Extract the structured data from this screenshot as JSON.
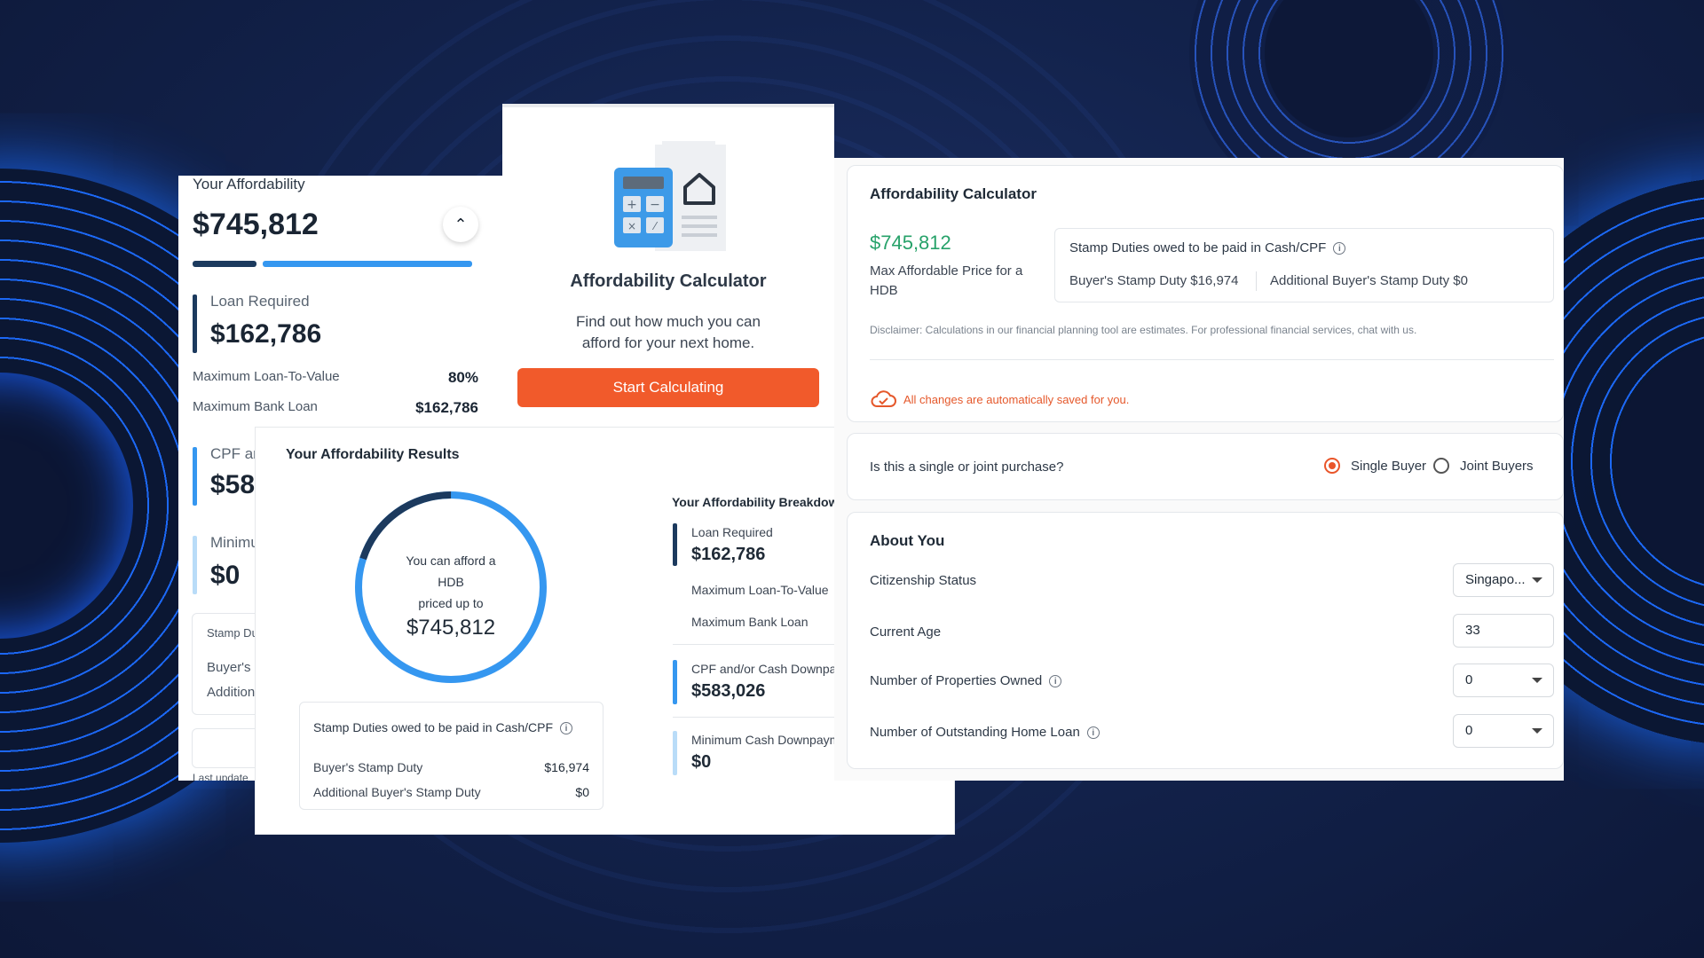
{
  "left_card": {
    "label": "Your Affordability",
    "amount": "$745,812",
    "loan_label": "Loan Required",
    "loan_value": "$162,786",
    "ltv_label": "Maximum Loan-To-Value",
    "ltv_value": "80%",
    "bank_loan_label": "Maximum Bank Loan",
    "bank_loan_value": "$162,786",
    "cpf_label_partial": "CPF ar",
    "cpf_value_partial": "$58",
    "min_label_partial": "Minimu",
    "min_value": "$0",
    "stamp_partial": "Stamp Du",
    "buyer_partial": "Buyer's",
    "additional_partial": "Addition",
    "last_update_partial": "Last update"
  },
  "intro_card": {
    "title": "Affordability Calculator",
    "description": "Find out how much you can afford for your next home.",
    "button": "Start Calculating"
  },
  "results_card": {
    "title": "Your Affordability Results",
    "donut_line1": "You can afford a",
    "donut_line2": "HDB",
    "donut_line3": "priced up to",
    "donut_value": "$745,812",
    "donut_fraction_dark": 0.2,
    "stamp_title": "Stamp Duties owed to be paid in Cash/CPF",
    "bsd_label": "Buyer's Stamp Duty",
    "bsd_value": "$16,974",
    "absd_label": "Additional Buyer's Stamp Duty",
    "absd_value": "$0",
    "breakdown_title": "Your Affordability Breakdown",
    "bk_loan_label": "Loan Required",
    "bk_loan_value": "$162,786",
    "bk_ltv_label": "Maximum Loan-To-Value",
    "bk_bank_label": "Maximum Bank Loan",
    "bk_cpf_label": "CPF and/or Cash Downpayment",
    "bk_cpf_value": "$583,026",
    "bk_min_label": "Minimum Cash Downpayment",
    "bk_min_value": "$0"
  },
  "right_panel": {
    "title": "Affordability Calculator",
    "price": "$745,812",
    "price_sub": "Max Affordable Price for a HDB",
    "stamp_title": "Stamp Duties owed to be paid in Cash/CPF",
    "bsd": "Buyer's Stamp Duty $16,974",
    "absd": "Additional Buyer's Stamp Duty $0",
    "disclaimer": "Disclaimer: Calculations in our financial planning tool are estimates. For professional financial services, chat with us.",
    "saved": "All changes are automatically saved for you.",
    "purchase_question": "Is this a single or joint purchase?",
    "single_buyer": "Single Buyer",
    "joint_buyers": "Joint Buyers",
    "selected_purchase": "Single Buyer",
    "about_title": "About You",
    "citizenship_label": "Citizenship Status",
    "citizenship_value": "Singapo...",
    "age_label": "Current Age",
    "age_value": "33",
    "properties_label": "Number of Properties Owned",
    "properties_value": "0",
    "loans_label": "Number of Outstanding Home Loan",
    "loans_value": "0"
  },
  "colors": {
    "accent_orange": "#f15a2b",
    "green": "#27a26a",
    "blue": "#3597f0",
    "navy": "#1c3a5e"
  }
}
